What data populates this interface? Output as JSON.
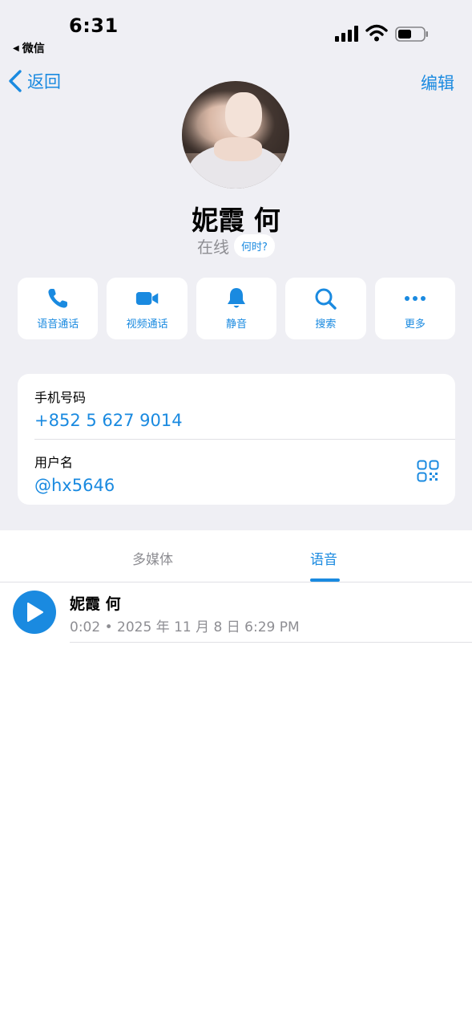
{
  "status_bar": {
    "time": "6:31",
    "back_app": "微信"
  },
  "nav": {
    "back_label": "返回",
    "edit_label": "编辑"
  },
  "profile": {
    "name": "妮霞 何",
    "status": "在线",
    "when_label": "何时?"
  },
  "actions": [
    {
      "label": "语音通话",
      "icon": "phone-icon"
    },
    {
      "label": "视频通话",
      "icon": "video-icon"
    },
    {
      "label": "静音",
      "icon": "bell-icon"
    },
    {
      "label": "搜索",
      "icon": "search-icon"
    },
    {
      "label": "更多",
      "icon": "more-icon"
    }
  ],
  "info": {
    "phone_label": "手机号码",
    "phone_value": "+852 5 627 9014",
    "username_label": "用户名",
    "username_value": "@hx5646"
  },
  "tabs": {
    "media": "多媒体",
    "voice": "语音",
    "active": "voice"
  },
  "voice_messages": [
    {
      "sender": "妮霞 何",
      "meta": "0:02 • 2025 年 11 月 8 日 6:29 PM"
    }
  ],
  "colors": {
    "accent": "#1a8ae0",
    "background": "#efeff4",
    "secondary_text": "#8e8e93"
  }
}
